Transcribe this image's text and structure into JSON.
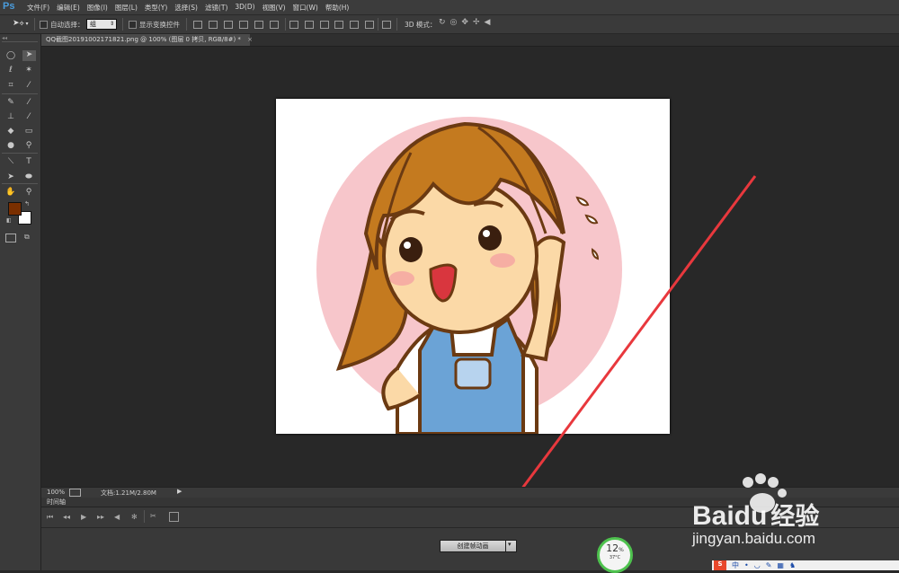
{
  "app": {
    "logo": "Ps"
  },
  "menu": [
    "文件(F)",
    "编辑(E)",
    "图像(I)",
    "图层(L)",
    "类型(Y)",
    "选择(S)",
    "滤镜(T)",
    "3D(D)",
    "视图(V)",
    "窗口(W)",
    "帮助(H)"
  ],
  "options": {
    "auto_select_label": "自动选择：",
    "auto_select_value": "组",
    "show_transform_label": "显示变换控件",
    "mode_3d_label": "3D 模式："
  },
  "document": {
    "tab_title": "QQ截图20191002171821.png @ 100% (图层 0 拷贝, RGB/8#) *",
    "tab_close": "×"
  },
  "status": {
    "zoom": "100%",
    "doc_info": "文档:1.21M/2.80M"
  },
  "timeline": {
    "title": "时间轴",
    "create_button": "创建帧动画"
  },
  "widget": {
    "percent": "12",
    "percent_sign": "%",
    "temp": "37°C"
  },
  "watermark": {
    "brand": "Baidu",
    "brand_cn": "经验",
    "url": "jingyan.baidu.com"
  },
  "colors": {
    "foreground": "#7a2f00",
    "background": "#ffffff",
    "accent_arrow": "#e8383d"
  },
  "icons": {
    "move_tool": "move-icon",
    "marquee": "marquee-icon",
    "lasso": "lasso-icon"
  }
}
